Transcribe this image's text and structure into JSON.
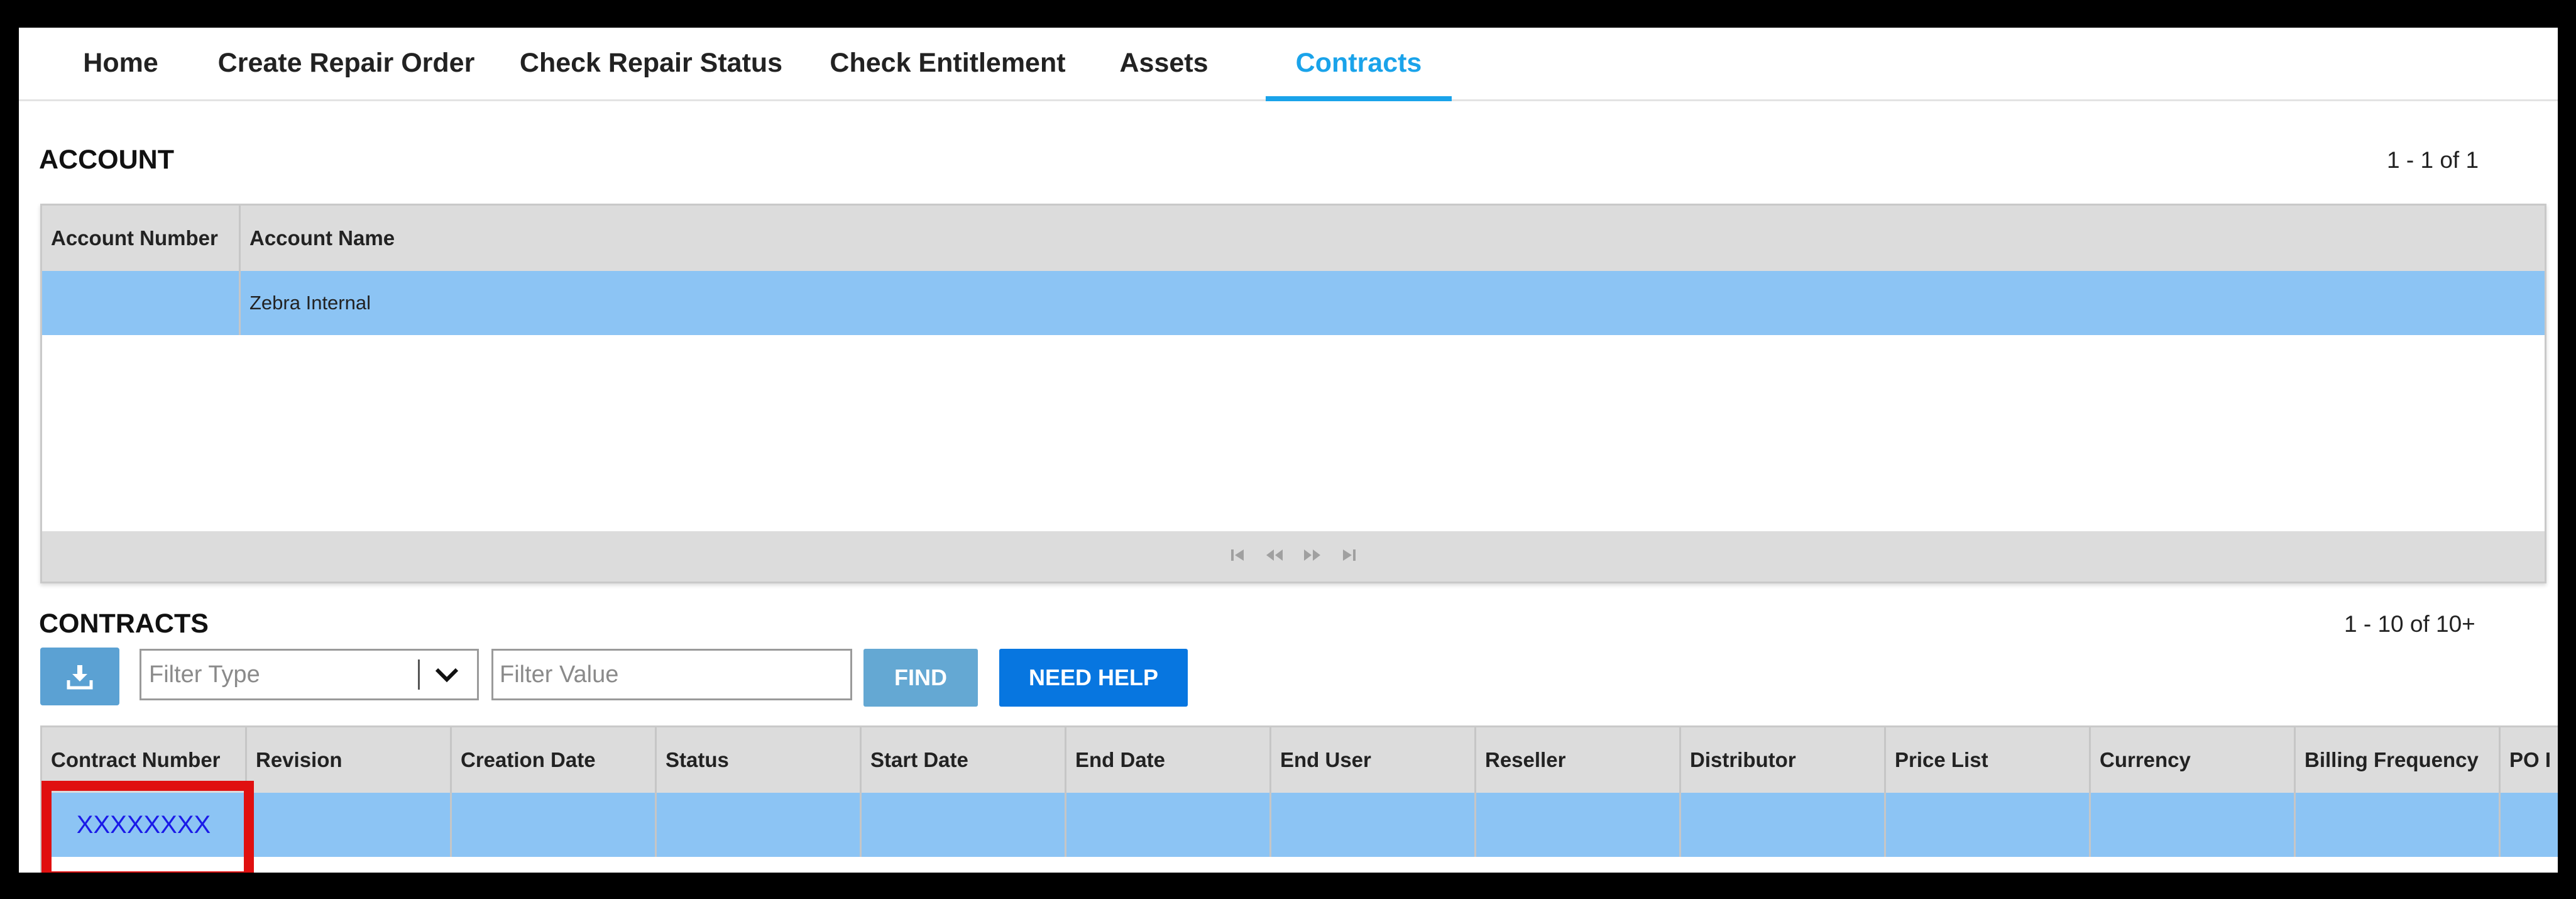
{
  "nav": {
    "tabs": [
      {
        "label": "Home"
      },
      {
        "label": "Create Repair Order"
      },
      {
        "label": "Check Repair Status"
      },
      {
        "label": "Check Entitlement"
      },
      {
        "label": "Assets"
      },
      {
        "label": "Contracts",
        "active": true
      }
    ],
    "active_color": "#1aa3ea"
  },
  "account": {
    "title": "ACCOUNT",
    "pager": "1 - 1 of 1",
    "columns": [
      "Account Number",
      "Account Name"
    ],
    "rows": [
      {
        "account_number": "",
        "account_name": "Zebra Internal"
      }
    ],
    "pagination_icons": [
      "first-page-icon",
      "prev-page-icon",
      "next-page-icon",
      "last-page-icon"
    ]
  },
  "contracts": {
    "title": "CONTRACTS",
    "pager": "1 - 10 of 10+",
    "toolbar": {
      "download_icon": "download-icon",
      "filter_type_placeholder": "Filter Type",
      "filter_value_placeholder": "Filter Value",
      "find_label": "FIND",
      "help_label": "NEED HELP"
    },
    "columns": [
      "Contract Number",
      "Revision",
      "Creation Date",
      "Status",
      "Start Date",
      "End Date",
      "End User",
      "Reseller",
      "Distributor",
      "Price List",
      "Currency",
      "Billing Frequency",
      "PO I"
    ],
    "rows": [
      {
        "contract_number": "XXXXXXXX"
      }
    ]
  },
  "colors": {
    "selected_row": "#8cc4f4",
    "find_button": "#64a8d3",
    "help_button": "#0776e0",
    "highlight": "#e01010"
  }
}
